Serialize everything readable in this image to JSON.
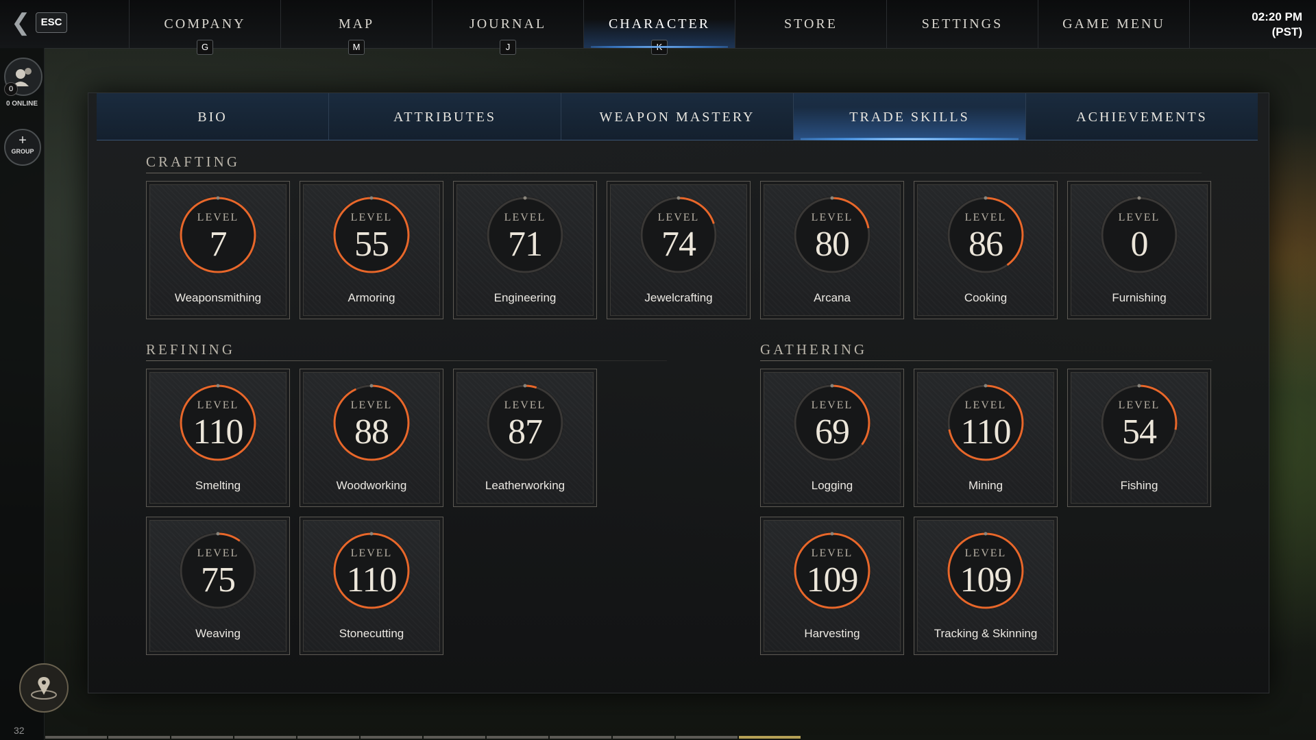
{
  "topbar": {
    "esc_label": "ESC",
    "tabs": [
      {
        "label": "COMPANY",
        "key": "G"
      },
      {
        "label": "MAP",
        "key": "M"
      },
      {
        "label": "JOURNAL",
        "key": "J"
      },
      {
        "label": "CHARACTER",
        "key": "K"
      },
      {
        "label": "STORE",
        "key": ""
      },
      {
        "label": "SETTINGS",
        "key": ""
      },
      {
        "label": "GAME MENU",
        "key": ""
      }
    ],
    "active_tab": "CHARACTER",
    "clock_time": "02:20 PM",
    "clock_zone": "(PST)"
  },
  "rail": {
    "online_count": "0",
    "online_label": "0 ONLINE",
    "group_plus": "+",
    "group_label": "GROUP",
    "page_number": "32"
  },
  "subtabs": {
    "items": [
      "BIO",
      "ATTRIBUTES",
      "WEAPON MASTERY",
      "TRADE SKILLS",
      "ACHIEVEMENTS"
    ],
    "active": "TRADE SKILLS"
  },
  "level_word": "LEVEL",
  "sections": {
    "crafting": "CRAFTING",
    "refining": "REFINING",
    "gathering": "GATHERING"
  },
  "skills": {
    "crafting": [
      {
        "name": "Weaponsmithing",
        "level": "7",
        "progress": 1.0
      },
      {
        "name": "Armoring",
        "level": "55",
        "progress": 1.0
      },
      {
        "name": "Engineering",
        "level": "71",
        "progress": 0.0
      },
      {
        "name": "Jewelcrafting",
        "level": "74",
        "progress": 0.2
      },
      {
        "name": "Arcana",
        "level": "80",
        "progress": 0.22
      },
      {
        "name": "Cooking",
        "level": "86",
        "progress": 0.4
      },
      {
        "name": "Furnishing",
        "level": "0",
        "progress": 0.0
      }
    ],
    "refining": [
      {
        "name": "Smelting",
        "level": "110",
        "progress": 1.0
      },
      {
        "name": "Woodworking",
        "level": "88",
        "progress": 0.93
      },
      {
        "name": "Leatherworking",
        "level": "87",
        "progress": 0.05
      },
      {
        "name": "Weaving",
        "level": "75",
        "progress": 0.1
      },
      {
        "name": "Stonecutting",
        "level": "110",
        "progress": 1.0
      }
    ],
    "gathering": [
      {
        "name": "Logging",
        "level": "69",
        "progress": 0.35
      },
      {
        "name": "Mining",
        "level": "110",
        "progress": 0.72
      },
      {
        "name": "Fishing",
        "level": "54",
        "progress": 0.28
      },
      {
        "name": "Harvesting",
        "level": "109",
        "progress": 1.0
      },
      {
        "name": "Tracking & Skinning",
        "level": "109",
        "progress": 1.0
      }
    ]
  },
  "colors": {
    "progress_ring": "#e8672a",
    "ring_track": "#3a3836",
    "active_tab_glow": "#4a97e8"
  }
}
